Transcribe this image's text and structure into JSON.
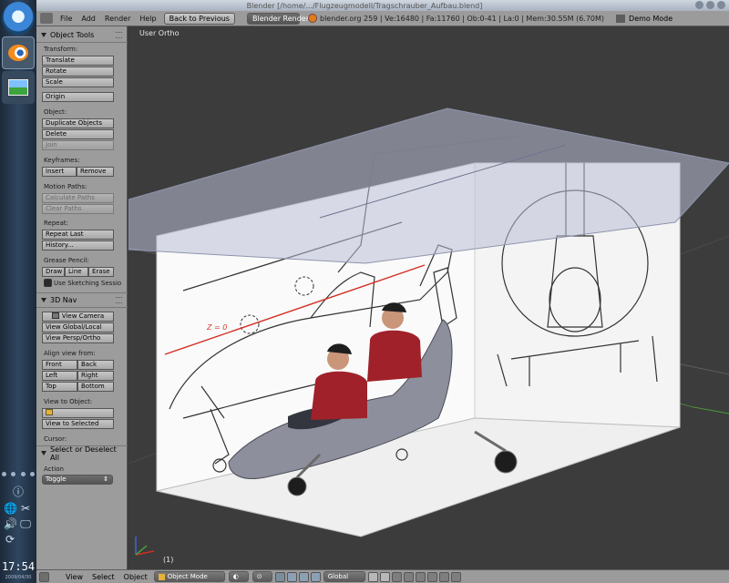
{
  "window": {
    "title": "Blender [/home/.../Flugzeugmodell/Tragschrauber_Aufbau.blend]"
  },
  "dock": {
    "time": "17:54",
    "date": "2009/04/30"
  },
  "header": {
    "menus": [
      "File",
      "Add",
      "Render",
      "Help"
    ],
    "back_button": "Back to Previous",
    "render_engine": "Blender Render",
    "stats": "blender.org 259 | Ve:16480 | Fa:11760 | Ob:0-41 | La:0 | Mem:30.55M (6.70M)",
    "demo_mode": "Demo Mode"
  },
  "toolshelf": {
    "object_tools_title": "Object Tools",
    "transform_label": "Transform:",
    "translate": "Translate",
    "rotate": "Rotate",
    "scale": "Scale",
    "origin": "Origin",
    "object_label": "Object:",
    "duplicate_objects": "Duplicate Objects",
    "delete": "Delete",
    "join": "Join",
    "keyframes_label": "Keyframes:",
    "insert": "Insert",
    "remove": "Remove",
    "motion_paths_label": "Motion Paths:",
    "calculate_paths": "Calculate Paths",
    "clear_paths": "Clear Paths",
    "repeat_label": "Repeat:",
    "repeat_last": "Repeat Last",
    "history": "History...",
    "grease_pencil_label": "Grease Pencil:",
    "draw": "Draw",
    "line": "Line",
    "erase": "Erase",
    "use_sketching": "Use Sketching Sessio",
    "nav_title": "3D Nav",
    "view_camera": "View Camera",
    "view_global_local": "View Global/Local",
    "view_persp_ortho": "View Persp/Ortho",
    "align_view_label": "Align view from:",
    "front": "Front",
    "back": "Back",
    "left": "Left",
    "right": "Right",
    "top": "Top",
    "bottom": "Bottom",
    "view_to_object_label": "View to Object:",
    "view_to_selected": "View to Selected",
    "cursor_label": "Cursor:",
    "select_title": "Select or Deselect All",
    "action_label": "Action",
    "action_value": "Toggle"
  },
  "viewport": {
    "view_label": "User Ortho",
    "frame_label": "(1)",
    "axis_label": "Z = 0"
  },
  "bottombar": {
    "menus": [
      "View",
      "Select",
      "Object"
    ],
    "mode": "Object Mode",
    "pivot": "Global"
  }
}
